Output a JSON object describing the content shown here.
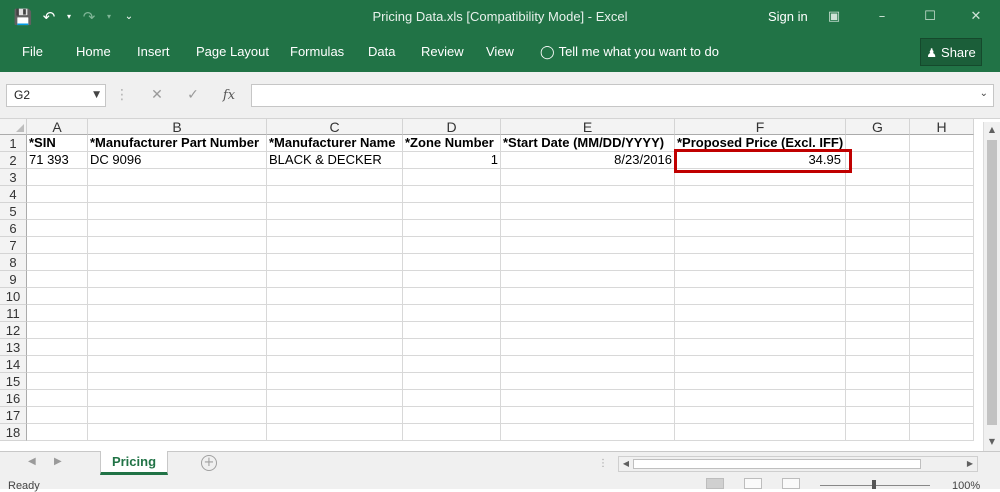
{
  "window": {
    "title": "Pricing Data.xls  [Compatibility Mode] - Excel",
    "sign_in": "Sign in"
  },
  "ribbon": {
    "tabs": [
      "File",
      "Home",
      "Insert",
      "Page Layout",
      "Formulas",
      "Data",
      "Review",
      "View"
    ],
    "tell_me": "Tell me what you want to do",
    "share": "Share"
  },
  "formula_bar": {
    "name_box": "G2",
    "fx_label": "fx",
    "formula": ""
  },
  "sheet": {
    "columns": [
      "A",
      "B",
      "C",
      "D",
      "E",
      "F",
      "G",
      "H"
    ],
    "row_numbers": [
      "1",
      "2",
      "3",
      "4",
      "5",
      "6",
      "7",
      "8",
      "9",
      "10",
      "11",
      "12",
      "13",
      "14",
      "15",
      "16",
      "17",
      "18"
    ],
    "header_row": [
      "*SIN",
      "*Manufacturer Part Number",
      "*Manufacturer Name",
      "*Zone Number",
      "*Start Date (MM/DD/YYYY)",
      "*Proposed Price (Excl. IFF)",
      "",
      ""
    ],
    "data_row": [
      "71 393",
      "DC 9096",
      "BLACK & DECKER",
      "1",
      "8/23/2016",
      "34.95",
      "",
      ""
    ],
    "highlight_color": "#C00000"
  },
  "sheet_tabs": {
    "active": "Pricing"
  },
  "status": {
    "ready": "Ready",
    "zoom": "100%"
  },
  "colors": {
    "excel_green": "#217346"
  }
}
